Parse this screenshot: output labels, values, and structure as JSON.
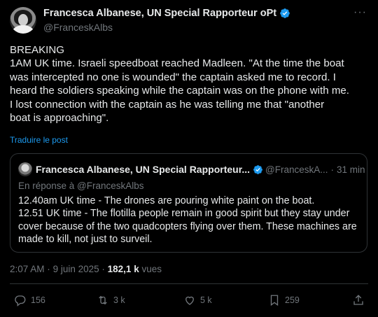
{
  "author": {
    "name": "Francesca Albanese, UN Special Rapporteur oPt",
    "handle": "@FranceskAlbs"
  },
  "more_icon": "more-icon",
  "tweet": {
    "lines": [
      "BREAKING",
      "1AM UK time. Israeli speedboat reached Madleen. \"At the time the boat",
      "was intercepted no one is wounded\" the captain asked me to record. I",
      "heard the soldiers speaking while the captain was on the phone with me.",
      "I lost connection with the captain as he was telling me that \"another",
      "boat is approaching\"."
    ],
    "translate_label": "Traduire le post"
  },
  "quote": {
    "name": "Francesca Albanese, UN Special Rapporteur...",
    "handle": "@FranceskA...",
    "separator": "·",
    "time": "31 min",
    "reply_to": "En réponse à @FranceskAlbs",
    "lines": [
      "12.40am UK time - The drones are pouring white paint on the boat.",
      "12.51 UK time - The flotilla people remain in good spirit but they stay under",
      "cover because of the two quadcopters flying over them. These machines are",
      "made to kill, not just to surveil."
    ]
  },
  "meta": {
    "time": "2:07 AM",
    "date": "9 juin 2025",
    "separator": "·",
    "views_count": "182,1 k",
    "views_label": "vues"
  },
  "actions": {
    "replies": "156",
    "reposts": "3 k",
    "likes": "5 k",
    "bookmarks": "259"
  },
  "colors": {
    "background": "#000000",
    "text": "#e7e9ea",
    "muted": "#71767b",
    "link": "#1d9bf0",
    "border": "#2f3336",
    "verified": "#1d9bf0"
  }
}
